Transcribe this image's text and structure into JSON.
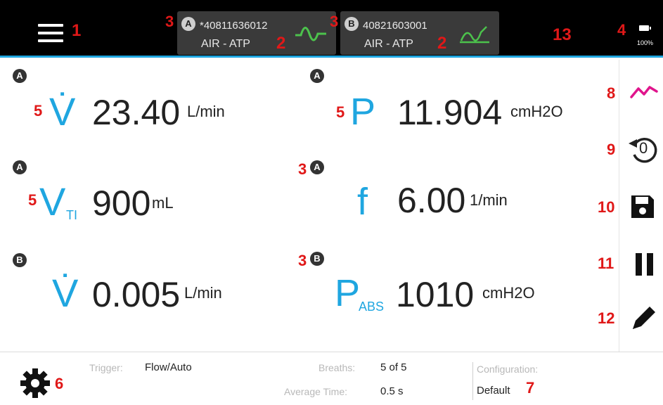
{
  "header": {
    "menu_icon": "hamburger-menu-icon",
    "device_a": {
      "letter": "A",
      "serial": "*40811636012",
      "gas": "AIR - ATP",
      "wave_icon": "sine-wave-icon"
    },
    "device_b": {
      "letter": "B",
      "serial": "40821603001",
      "gas": "AIR - ATP",
      "wave_icon": "breath-wave-icon"
    },
    "battery": {
      "icon": "battery-icon",
      "percent": "100%"
    }
  },
  "callouts": {
    "c1": "1",
    "c2": "2",
    "c3": "3",
    "c4": "4",
    "c5": "5",
    "c6": "6",
    "c7": "7",
    "c8": "8",
    "c9": "9",
    "c10": "10",
    "c11": "11",
    "c12": "12",
    "c13": "13"
  },
  "tiles": {
    "t1": {
      "device": "A",
      "symbol": "V̇",
      "value": "23.40",
      "unit": "L/min"
    },
    "t2": {
      "device": "A",
      "symbol": "P",
      "value": "11.904",
      "unit": "cmH2O"
    },
    "t3": {
      "device": "A",
      "symbol": "V",
      "sub": "TI",
      "value": "900",
      "unit": "mL"
    },
    "t4": {
      "device": "A",
      "symbol": "f",
      "value": "6.00",
      "unit": "1/min"
    },
    "t5": {
      "device": "B",
      "symbol": "V̇",
      "value": "0.005",
      "unit": "L/min"
    },
    "t6": {
      "device": "B",
      "symbol": "P",
      "sub": "ABS",
      "value": "1010",
      "unit": "cmH2O"
    }
  },
  "sidebar": {
    "icons": [
      "trend-chart-icon",
      "zero-reset-icon",
      "save-icon",
      "pause-icon",
      "edit-pencil-icon"
    ],
    "zero_glyph": "0",
    "accent": "#e0148c"
  },
  "footer": {
    "settings_icon": "gear-icon",
    "trigger_label": "Trigger:",
    "trigger_value": "Flow/Auto",
    "breaths_label": "Breaths:",
    "breaths_value": "5 of 5",
    "avg_label": "Average Time:",
    "avg_value": "0.5 s",
    "config_label": "Configuration:",
    "config_value": "Default"
  },
  "colors": {
    "accent_blue": "#1fa6e0",
    "callout_red": "#e01818",
    "wave_green": "#4cc24c"
  }
}
